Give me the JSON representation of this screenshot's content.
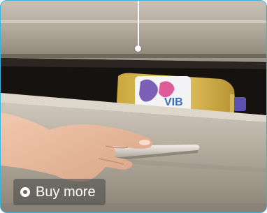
{
  "action": {
    "label": "Buy more",
    "icon": "radio-circle-icon"
  },
  "colors": {
    "frame_border": "#3bb2dc",
    "badge_background": "rgba(70,70,70,0.55)",
    "badge_text": "#ffffff"
  }
}
